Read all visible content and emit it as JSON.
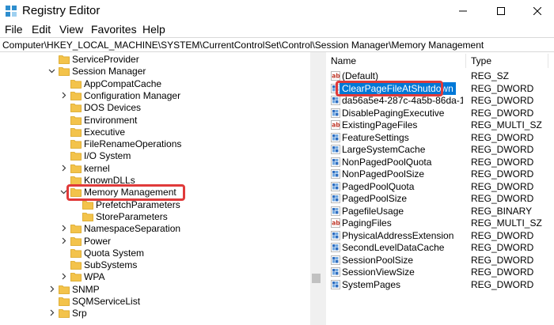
{
  "window": {
    "title": "Registry Editor",
    "icon": "registry-editor-icon",
    "controls": [
      "minimize-icon",
      "maximize-icon",
      "close-icon"
    ]
  },
  "menu": [
    "File",
    "Edit",
    "View",
    "Favorites",
    "Help"
  ],
  "address": "Computer\\HKEY_LOCAL_MACHINE\\SYSTEM\\CurrentControlSet\\Control\\Session Manager\\Memory Management",
  "tree": [
    {
      "label": "ServiceProvider",
      "level": 0,
      "chevron": "none"
    },
    {
      "label": "Session Manager",
      "level": 0,
      "chevron": "expanded"
    },
    {
      "label": "AppCompatCache",
      "level": 1,
      "chevron": "none"
    },
    {
      "label": "Configuration Manager",
      "level": 1,
      "chevron": "collapsed"
    },
    {
      "label": "DOS Devices",
      "level": 1,
      "chevron": "none"
    },
    {
      "label": "Environment",
      "level": 1,
      "chevron": "none"
    },
    {
      "label": "Executive",
      "level": 1,
      "chevron": "none"
    },
    {
      "label": "FileRenameOperations",
      "level": 1,
      "chevron": "none"
    },
    {
      "label": "I/O System",
      "level": 1,
      "chevron": "none"
    },
    {
      "label": "kernel",
      "level": 1,
      "chevron": "collapsed"
    },
    {
      "label": "KnownDLLs",
      "level": 1,
      "chevron": "none"
    },
    {
      "label": "Memory Management",
      "level": 1,
      "chevron": "expanded",
      "selected": true
    },
    {
      "label": "PrefetchParameters",
      "level": 2,
      "chevron": "none"
    },
    {
      "label": "StoreParameters",
      "level": 2,
      "chevron": "none"
    },
    {
      "label": "NamespaceSeparation",
      "level": 1,
      "chevron": "collapsed"
    },
    {
      "label": "Power",
      "level": 1,
      "chevron": "collapsed"
    },
    {
      "label": "Quota System",
      "level": 1,
      "chevron": "none"
    },
    {
      "label": "SubSystems",
      "level": 1,
      "chevron": "none"
    },
    {
      "label": "WPA",
      "level": 1,
      "chevron": "collapsed"
    },
    {
      "label": "SNMP",
      "level": 0,
      "chevron": "collapsed"
    },
    {
      "label": "SQMServiceList",
      "level": 0,
      "chevron": "none"
    },
    {
      "label": "Srp",
      "level": 0,
      "chevron": "collapsed"
    }
  ],
  "list": {
    "columns": {
      "name": "Name",
      "type": "Type"
    },
    "rows": [
      {
        "name": "(Default)",
        "type": "REG_SZ",
        "icon": "string-value-icon"
      },
      {
        "name": "ClearPageFileAtShutdown",
        "type": "REG_DWORD",
        "icon": "binary-value-icon",
        "selected": true
      },
      {
        "name": "da56a5e4-287c-4a5b-86da-140a1...",
        "type": "REG_DWORD",
        "icon": "binary-value-icon"
      },
      {
        "name": "DisablePagingExecutive",
        "type": "REG_DWORD",
        "icon": "binary-value-icon"
      },
      {
        "name": "ExistingPageFiles",
        "type": "REG_MULTI_SZ",
        "icon": "string-value-icon"
      },
      {
        "name": "FeatureSettings",
        "type": "REG_DWORD",
        "icon": "binary-value-icon"
      },
      {
        "name": "LargeSystemCache",
        "type": "REG_DWORD",
        "icon": "binary-value-icon"
      },
      {
        "name": "NonPagedPoolQuota",
        "type": "REG_DWORD",
        "icon": "binary-value-icon"
      },
      {
        "name": "NonPagedPoolSize",
        "type": "REG_DWORD",
        "icon": "binary-value-icon"
      },
      {
        "name": "PagedPoolQuota",
        "type": "REG_DWORD",
        "icon": "binary-value-icon"
      },
      {
        "name": "PagedPoolSize",
        "type": "REG_DWORD",
        "icon": "binary-value-icon"
      },
      {
        "name": "PagefileUsage",
        "type": "REG_BINARY",
        "icon": "binary-value-icon"
      },
      {
        "name": "PagingFiles",
        "type": "REG_MULTI_SZ",
        "icon": "string-value-icon"
      },
      {
        "name": "PhysicalAddressExtension",
        "type": "REG_DWORD",
        "icon": "binary-value-icon"
      },
      {
        "name": "SecondLevelDataCache",
        "type": "REG_DWORD",
        "icon": "binary-value-icon"
      },
      {
        "name": "SessionPoolSize",
        "type": "REG_DWORD",
        "icon": "binary-value-icon"
      },
      {
        "name": "SessionViewSize",
        "type": "REG_DWORD",
        "icon": "binary-value-icon"
      },
      {
        "name": "SystemPages",
        "type": "REG_DWORD",
        "icon": "binary-value-icon"
      }
    ]
  },
  "colors": {
    "selection": "#0078d7",
    "highlight_box": "#e03a3a",
    "folder": "#f3c34b"
  }
}
